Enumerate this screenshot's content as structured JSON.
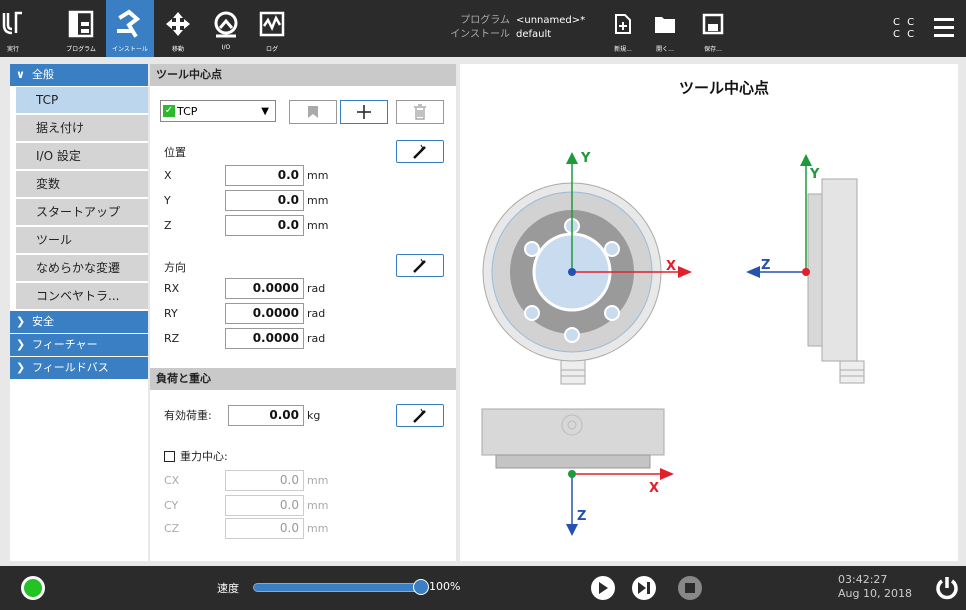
{
  "topbar": {
    "run_label": "実行",
    "program_label": "プログラム",
    "install_label": "インストール",
    "move_label": "移動",
    "io_label": "I/O",
    "log_label": "ログ",
    "program_key": "プログラム",
    "program_value": "<unnamed>*",
    "installation_key": "インストール",
    "installation_value": "default",
    "new_label": "新規...",
    "open_label": "開く...",
    "save_label": "保存...",
    "cc_line1": "C C",
    "cc_line2": "C C"
  },
  "sidebar": {
    "general": "全般",
    "items": [
      "TCP",
      "据え付け",
      "I/O 設定",
      "変数",
      "スタートアップ",
      "ツール",
      "なめらかな変遷",
      "コンベヤトラ..."
    ],
    "safety": "安全",
    "features": "フィーチャー",
    "fieldbus": "フィールドバス"
  },
  "tcp": {
    "section_title": "ツール中心点",
    "selected_tcp": "TCP",
    "position_label": "位置",
    "x_label": "X",
    "x_value": "0.0",
    "x_unit": "mm",
    "y_label": "Y",
    "y_value": "0.0",
    "y_unit": "mm",
    "z_label": "Z",
    "z_value": "0.0",
    "z_unit": "mm",
    "orientation_label": "方向",
    "rx_label": "RX",
    "rx_value": "0.0000",
    "rx_unit": "rad",
    "ry_label": "RY",
    "ry_value": "0.0000",
    "ry_unit": "rad",
    "rz_label": "RZ",
    "rz_value": "0.0000",
    "rz_unit": "rad"
  },
  "payload": {
    "section_title": "負荷と重心",
    "payload_label": "有効荷重:",
    "payload_value": "0.00",
    "payload_unit": "kg",
    "cog_label": "重力中心:",
    "cx_label": "CX",
    "cx_value": "0.0",
    "cx_unit": "mm",
    "cy_label": "CY",
    "cy_value": "0.0",
    "cy_unit": "mm",
    "cz_label": "CZ",
    "cz_value": "0.0",
    "cz_unit": "mm"
  },
  "diagram": {
    "title": "ツール中心点",
    "axis_x": "X",
    "axis_y": "Y",
    "axis_z": "Z"
  },
  "bottombar": {
    "speed_label": "速度",
    "speed_value": "100%",
    "speed_fraction": 1.0,
    "time": "03:42:27",
    "date": "Aug 10, 2018"
  },
  "colors": {
    "accent": "#3a7fc3",
    "axis_x": "#e0202a",
    "axis_y": "#1f9a3a",
    "axis_z": "#2452b0",
    "status_ok": "#22c322"
  }
}
